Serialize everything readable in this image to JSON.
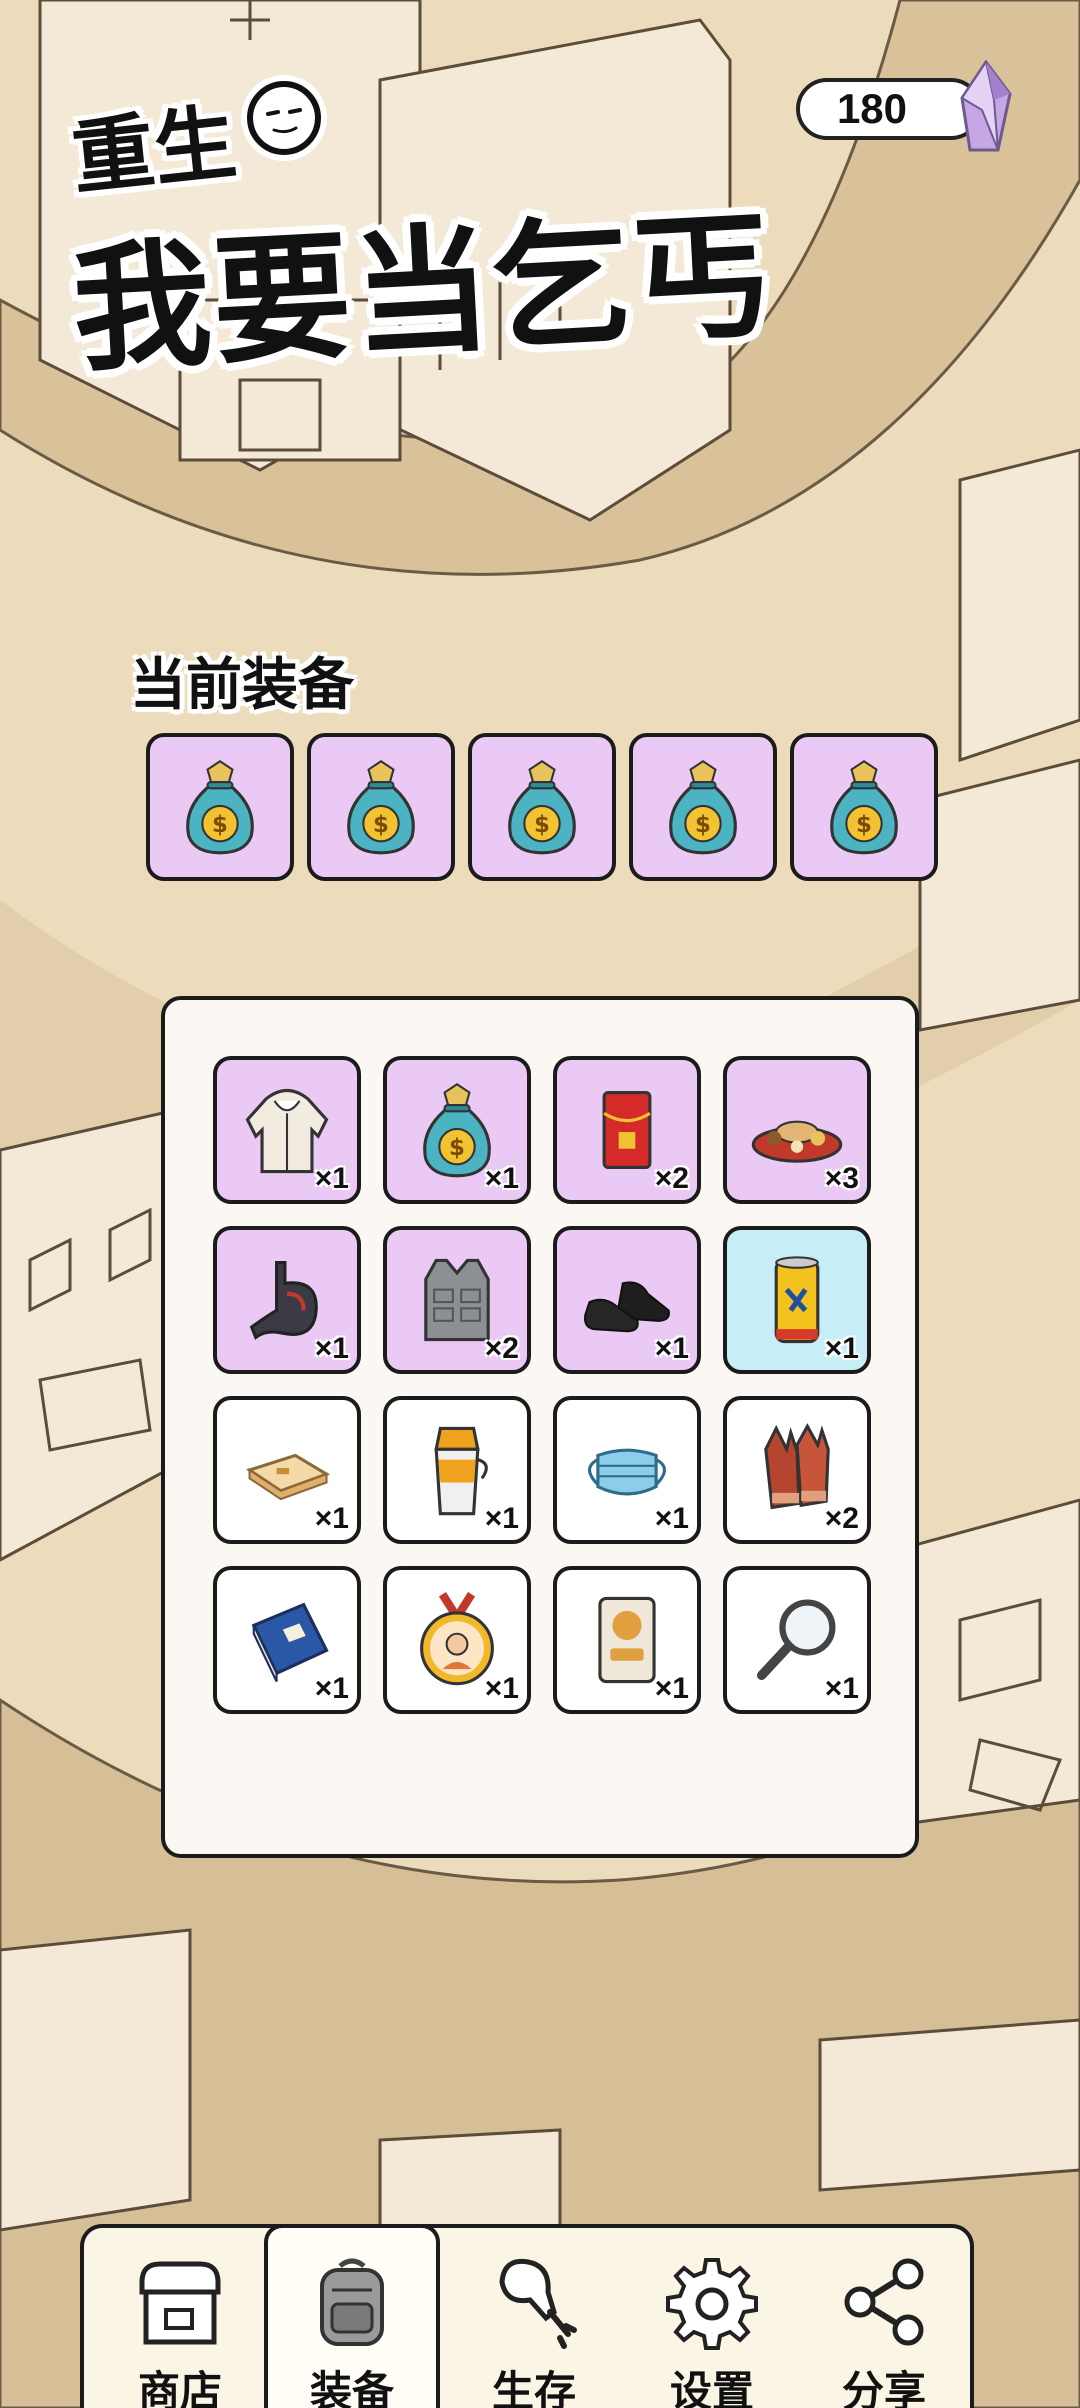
{
  "title": {
    "line1": "重生",
    "line2": "我要当乞丐"
  },
  "currency": {
    "value": "180",
    "icon": "purple-gem-icon"
  },
  "equipped": {
    "label": "当前装备",
    "slots": [
      {
        "icon": "money-bag-icon"
      },
      {
        "icon": "money-bag-icon"
      },
      {
        "icon": "money-bag-icon"
      },
      {
        "icon": "money-bag-icon"
      },
      {
        "icon": "money-bag-icon"
      }
    ]
  },
  "inventory": {
    "items": [
      {
        "icon": "hoodie-icon",
        "count": "×1",
        "rarity": "purple"
      },
      {
        "icon": "money-bag-icon",
        "count": "×1",
        "rarity": "purple"
      },
      {
        "icon": "red-envelope-icon",
        "count": "×2",
        "rarity": "purple"
      },
      {
        "icon": "cake-platter-icon",
        "count": "×3",
        "rarity": "purple"
      },
      {
        "icon": "stomach-icon",
        "count": "×1",
        "rarity": "purple"
      },
      {
        "icon": "armor-vest-icon",
        "count": "×2",
        "rarity": "purple"
      },
      {
        "icon": "black-shoes-icon",
        "count": "×1",
        "rarity": "purple"
      },
      {
        "icon": "soda-can-icon",
        "count": "×1",
        "rarity": "blue"
      },
      {
        "icon": "bread-slice-icon",
        "count": "×1",
        "rarity": "white"
      },
      {
        "icon": "juice-cup-icon",
        "count": "×1",
        "rarity": "white"
      },
      {
        "icon": "face-mask-icon",
        "count": "×1",
        "rarity": "white"
      },
      {
        "icon": "gloves-icon",
        "count": "×2",
        "rarity": "white"
      },
      {
        "icon": "book-icon",
        "count": "×1",
        "rarity": "white"
      },
      {
        "icon": "medal-icon",
        "count": "×1",
        "rarity": "white"
      },
      {
        "icon": "gym-card-icon",
        "count": "×1",
        "rarity": "white"
      },
      {
        "icon": "magnifier-icon",
        "count": "×1",
        "rarity": "white"
      }
    ]
  },
  "nav": {
    "items": [
      {
        "label": "商店",
        "icon": "shop-icon",
        "active": false
      },
      {
        "label": "装备",
        "icon": "backpack-icon",
        "active": true
      },
      {
        "label": "生存",
        "icon": "drumstick-icon",
        "active": false
      },
      {
        "label": "设置",
        "icon": "gear-icon",
        "active": false
      },
      {
        "label": "分享",
        "icon": "share-icon",
        "active": false
      }
    ]
  },
  "colors": {
    "background": "#ecdcbb",
    "slot_purple": "#eacaf5",
    "slot_blue": "#c7eef7",
    "outline": "#1b1b1b"
  }
}
